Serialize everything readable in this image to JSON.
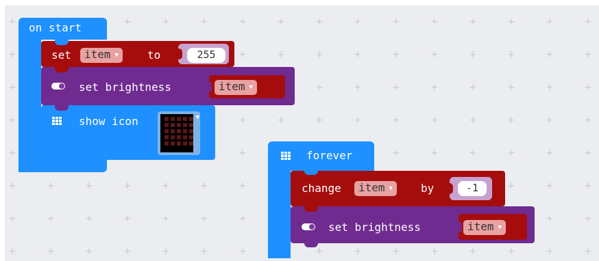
{
  "workspace": {
    "background": "#ecedf0",
    "grid_symbol": "+"
  },
  "colors": {
    "event_blue": "#1e90ff",
    "variable_red": "#a50d0d",
    "led_purple": "#6f2b8f",
    "basic_blue": "#1e90ff"
  },
  "on_start": {
    "title": "on start",
    "set_block": {
      "keyword": "set",
      "variable": "item",
      "to_label": "to",
      "value": "255"
    },
    "brightness_block": {
      "icon": "toggle-icon",
      "label": "set brightness",
      "variable": "item"
    },
    "show_icon_block": {
      "icon": "grid-icon",
      "label": "show icon",
      "image": "led-heart-icon"
    }
  },
  "forever": {
    "title": "forever",
    "icon": "grid-icon",
    "change_block": {
      "keyword": "change",
      "variable": "item",
      "by_label": "by",
      "value": "-1"
    },
    "brightness_block": {
      "icon": "toggle-icon",
      "label": "set brightness",
      "variable": "item"
    }
  }
}
